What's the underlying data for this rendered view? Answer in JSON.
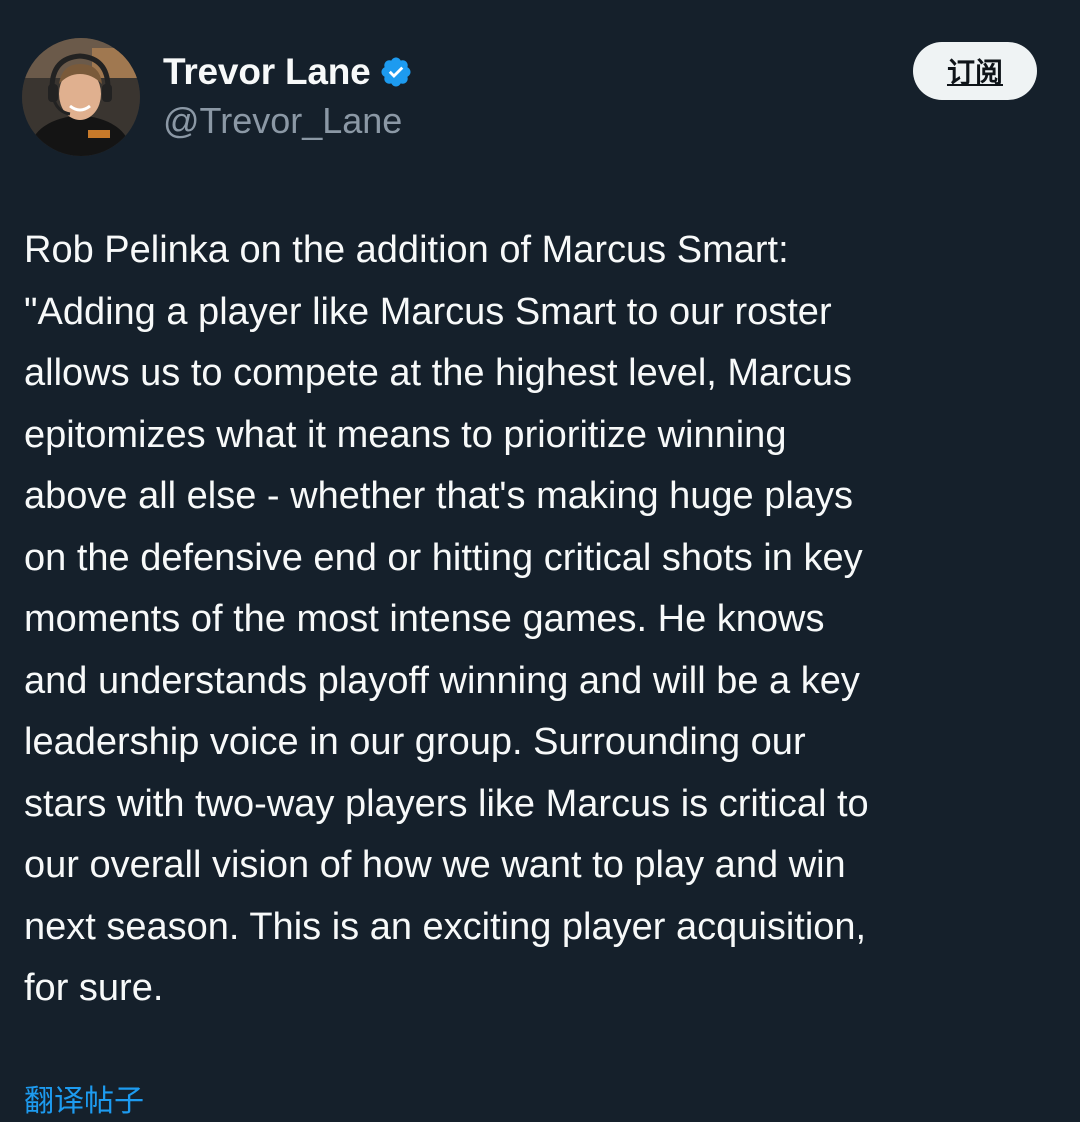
{
  "author": {
    "display_name": "Trevor Lane",
    "handle": "@Trevor_Lane",
    "verified": true,
    "avatar_icon": "profile-photo"
  },
  "actions": {
    "subscribe_label": "订阅"
  },
  "tweet": {
    "text": "Rob Pelinka on the addition of Marcus Smart:\n\"Adding a player like Marcus Smart to our roster\nallows us to compete at the highest level, Marcus\nepitomizes what it means to prioritize winning\nabove all else - whether that's making huge plays\non the defensive end or hitting critical shots in key\nmoments of the most intense games. He knows\nand understands playoff winning and will be a key\nleadership voice in our group. Surrounding our\nstars with two-way players like Marcus is critical to\nour overall vision of how we want to play and win\nnext season. This is an exciting player acquisition,\nfor sure.",
    "translate_label": "翻译帖子"
  },
  "colors": {
    "background": "#15202b",
    "text_primary": "#f7f9f9",
    "text_secondary": "#8b98a5",
    "accent": "#1d9bf0",
    "button_bg": "#eff3f4"
  }
}
